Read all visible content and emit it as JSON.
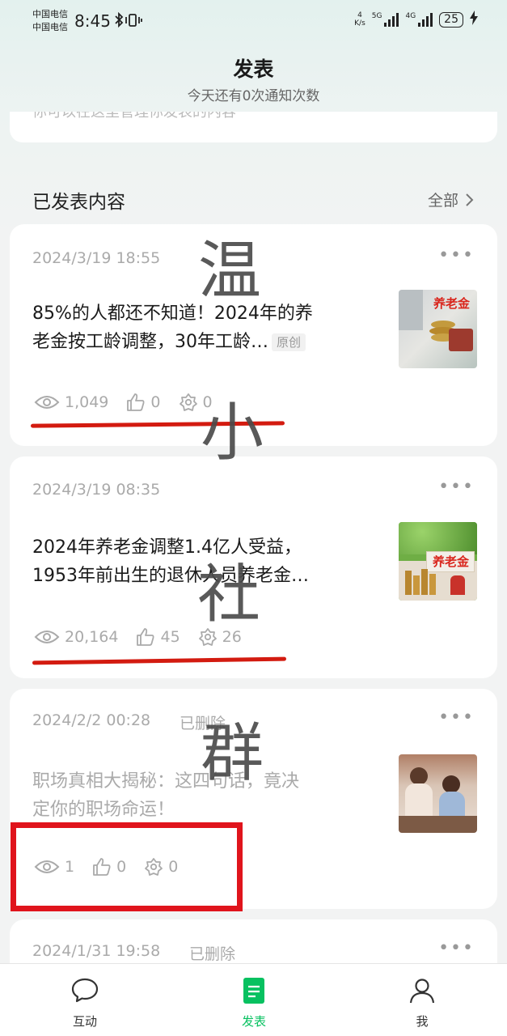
{
  "status_bar": {
    "carrier_1": "中国电信",
    "carrier_2": "中国电信",
    "time": "8:45",
    "net_speed_value": "4",
    "net_speed_unit": "K/s",
    "sig1_label": "5G",
    "sig2_label": "4G",
    "battery": "25"
  },
  "header": {
    "title": "发表",
    "subtitle": "今天还有0次通知次数"
  },
  "top_card_text": "你可以在这里管理你发表的内容",
  "section": {
    "title": "已发表内容",
    "more": "全部"
  },
  "posts": [
    {
      "date": "2024/3/19 18:55",
      "title": "85%的人都还不知道！2024年的养老金按工龄调整，30年工龄…",
      "title_line1": "85%的人都还不知道！2024年的养",
      "title_line2": "老金按工龄调整，30年工龄…",
      "badge": "原创",
      "views": "1,049",
      "likes": "0",
      "shares": "0",
      "thumb_label": "养老金"
    },
    {
      "date": "2024/3/19 08:35",
      "title_line1": "2024年养老金调整1.4亿人受益，",
      "title_line2": "1953年前出生的退休人员养老金…",
      "views": "20,164",
      "likes": "45",
      "shares": "26",
      "thumb_label": "养老金"
    },
    {
      "date": "2024/2/2 00:28",
      "status": "已删除",
      "title_line1": "职场真相大揭秘：这四句话，竟决",
      "title_line2": "定你的职场命运！",
      "views": "1",
      "likes": "0",
      "shares": "0"
    },
    {
      "date": "2024/1/31 19:58",
      "status": "已删除"
    }
  ],
  "watermark": [
    "温",
    "小",
    "社",
    "群"
  ],
  "nav": [
    {
      "label": "互动",
      "icon": "chat-bubble-icon"
    },
    {
      "label": "发表",
      "icon": "document-icon"
    },
    {
      "label": "我",
      "icon": "person-icon"
    }
  ],
  "colors": {
    "accent_green": "#07c160",
    "annotation_red": "#d31b10"
  }
}
